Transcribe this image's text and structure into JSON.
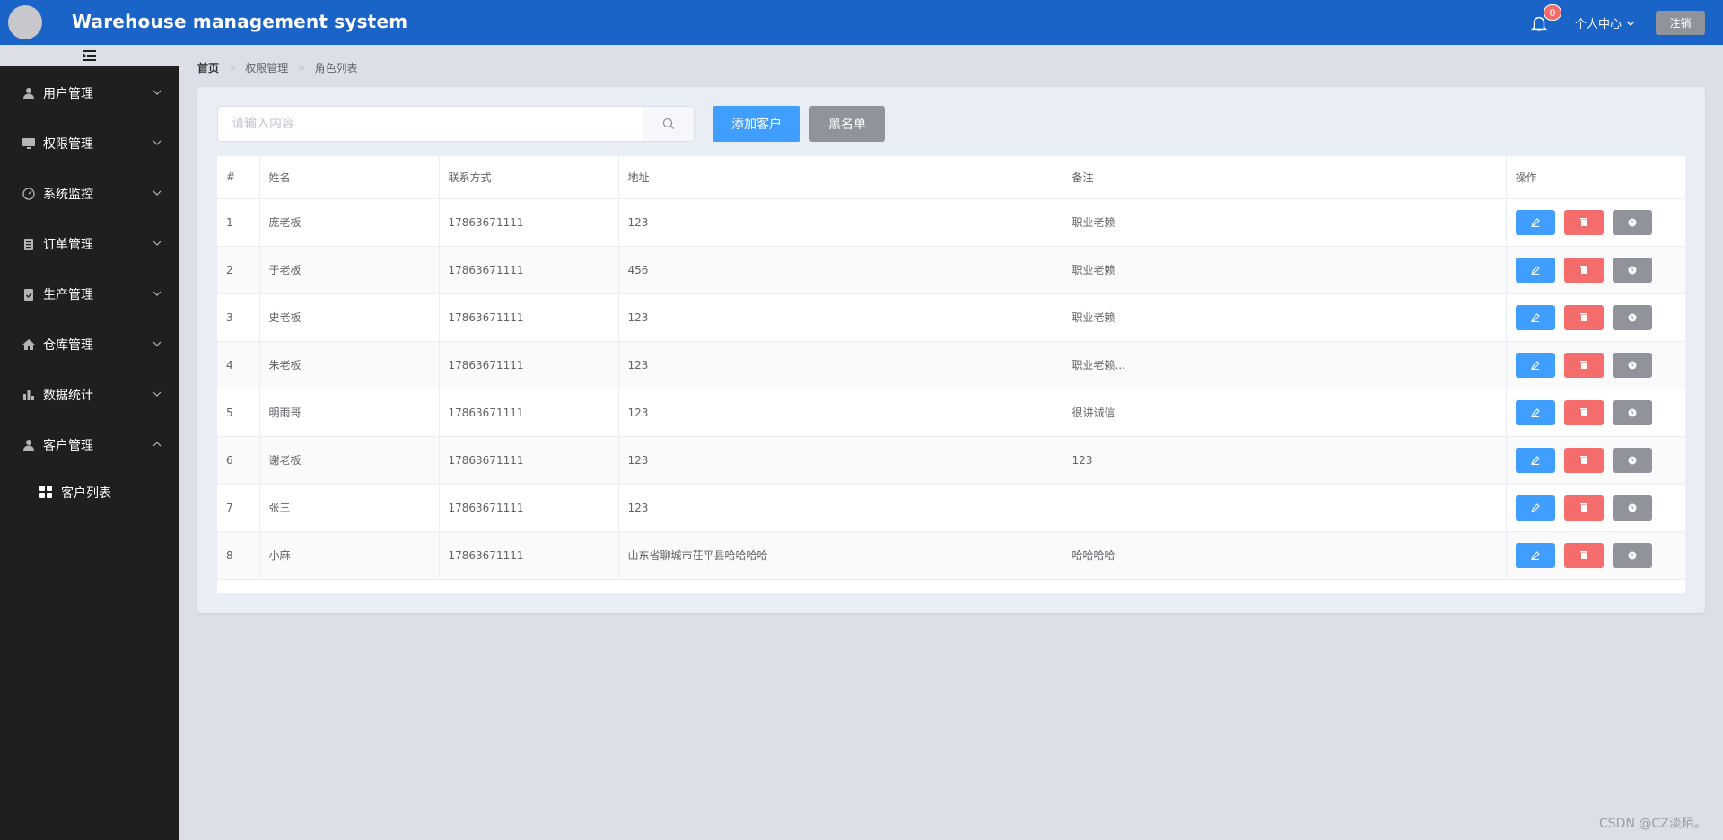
{
  "header": {
    "app_title": "Warehouse management system",
    "notification_count": "0",
    "personal_center_label": "个人中心",
    "logout_label": "注销",
    "accent_color": "#1a64c8"
  },
  "sidebar": {
    "items": [
      {
        "label": "用户管理",
        "icon": "user-icon"
      },
      {
        "label": "权限管理",
        "icon": "monitor-icon"
      },
      {
        "label": "系统监控",
        "icon": "gauge-icon"
      },
      {
        "label": "订单管理",
        "icon": "clipboard-icon"
      },
      {
        "label": "生产管理",
        "icon": "checklist-icon"
      },
      {
        "label": "仓库管理",
        "icon": "home-icon"
      },
      {
        "label": "数据统计",
        "icon": "bar-chart-icon"
      },
      {
        "label": "客户管理",
        "icon": "user-icon"
      }
    ],
    "sub_item": {
      "label": "客户列表",
      "icon": "grid-icon"
    }
  },
  "breadcrumb": [
    "首页",
    "权限管理",
    "角色列表"
  ],
  "search": {
    "placeholder": "请输入内容",
    "value": ""
  },
  "actions": {
    "add_label": "添加客户",
    "blacklist_label": "黑名单"
  },
  "table": {
    "headers": [
      "#",
      "姓名",
      "联系方式",
      "地址",
      "备注",
      "操作"
    ],
    "rows": [
      {
        "no": "1",
        "name": "庞老板",
        "phone": "17863671111",
        "address": "123",
        "note": "职业老赖"
      },
      {
        "no": "2",
        "name": "于老板",
        "phone": "17863671111",
        "address": "456",
        "note": "职业老赖"
      },
      {
        "no": "3",
        "name": "史老板",
        "phone": "17863671111",
        "address": "123",
        "note": "职业老赖"
      },
      {
        "no": "4",
        "name": "朱老板",
        "phone": "17863671111",
        "address": "123",
        "note": "职业老赖..."
      },
      {
        "no": "5",
        "name": "明雨哥",
        "phone": "17863671111",
        "address": "123",
        "note": "很讲诚信"
      },
      {
        "no": "6",
        "name": "谢老板",
        "phone": "17863671111",
        "address": "123",
        "note": "123"
      },
      {
        "no": "7",
        "name": "张三",
        "phone": "17863671111",
        "address": "123",
        "note": ""
      },
      {
        "no": "8",
        "name": "小麻",
        "phone": "17863671111",
        "address": "山东省聊城市茌平县哈哈哈哈",
        "note": "哈哈哈哈"
      }
    ]
  },
  "watermark": "CSDN @CZ淡陌。"
}
